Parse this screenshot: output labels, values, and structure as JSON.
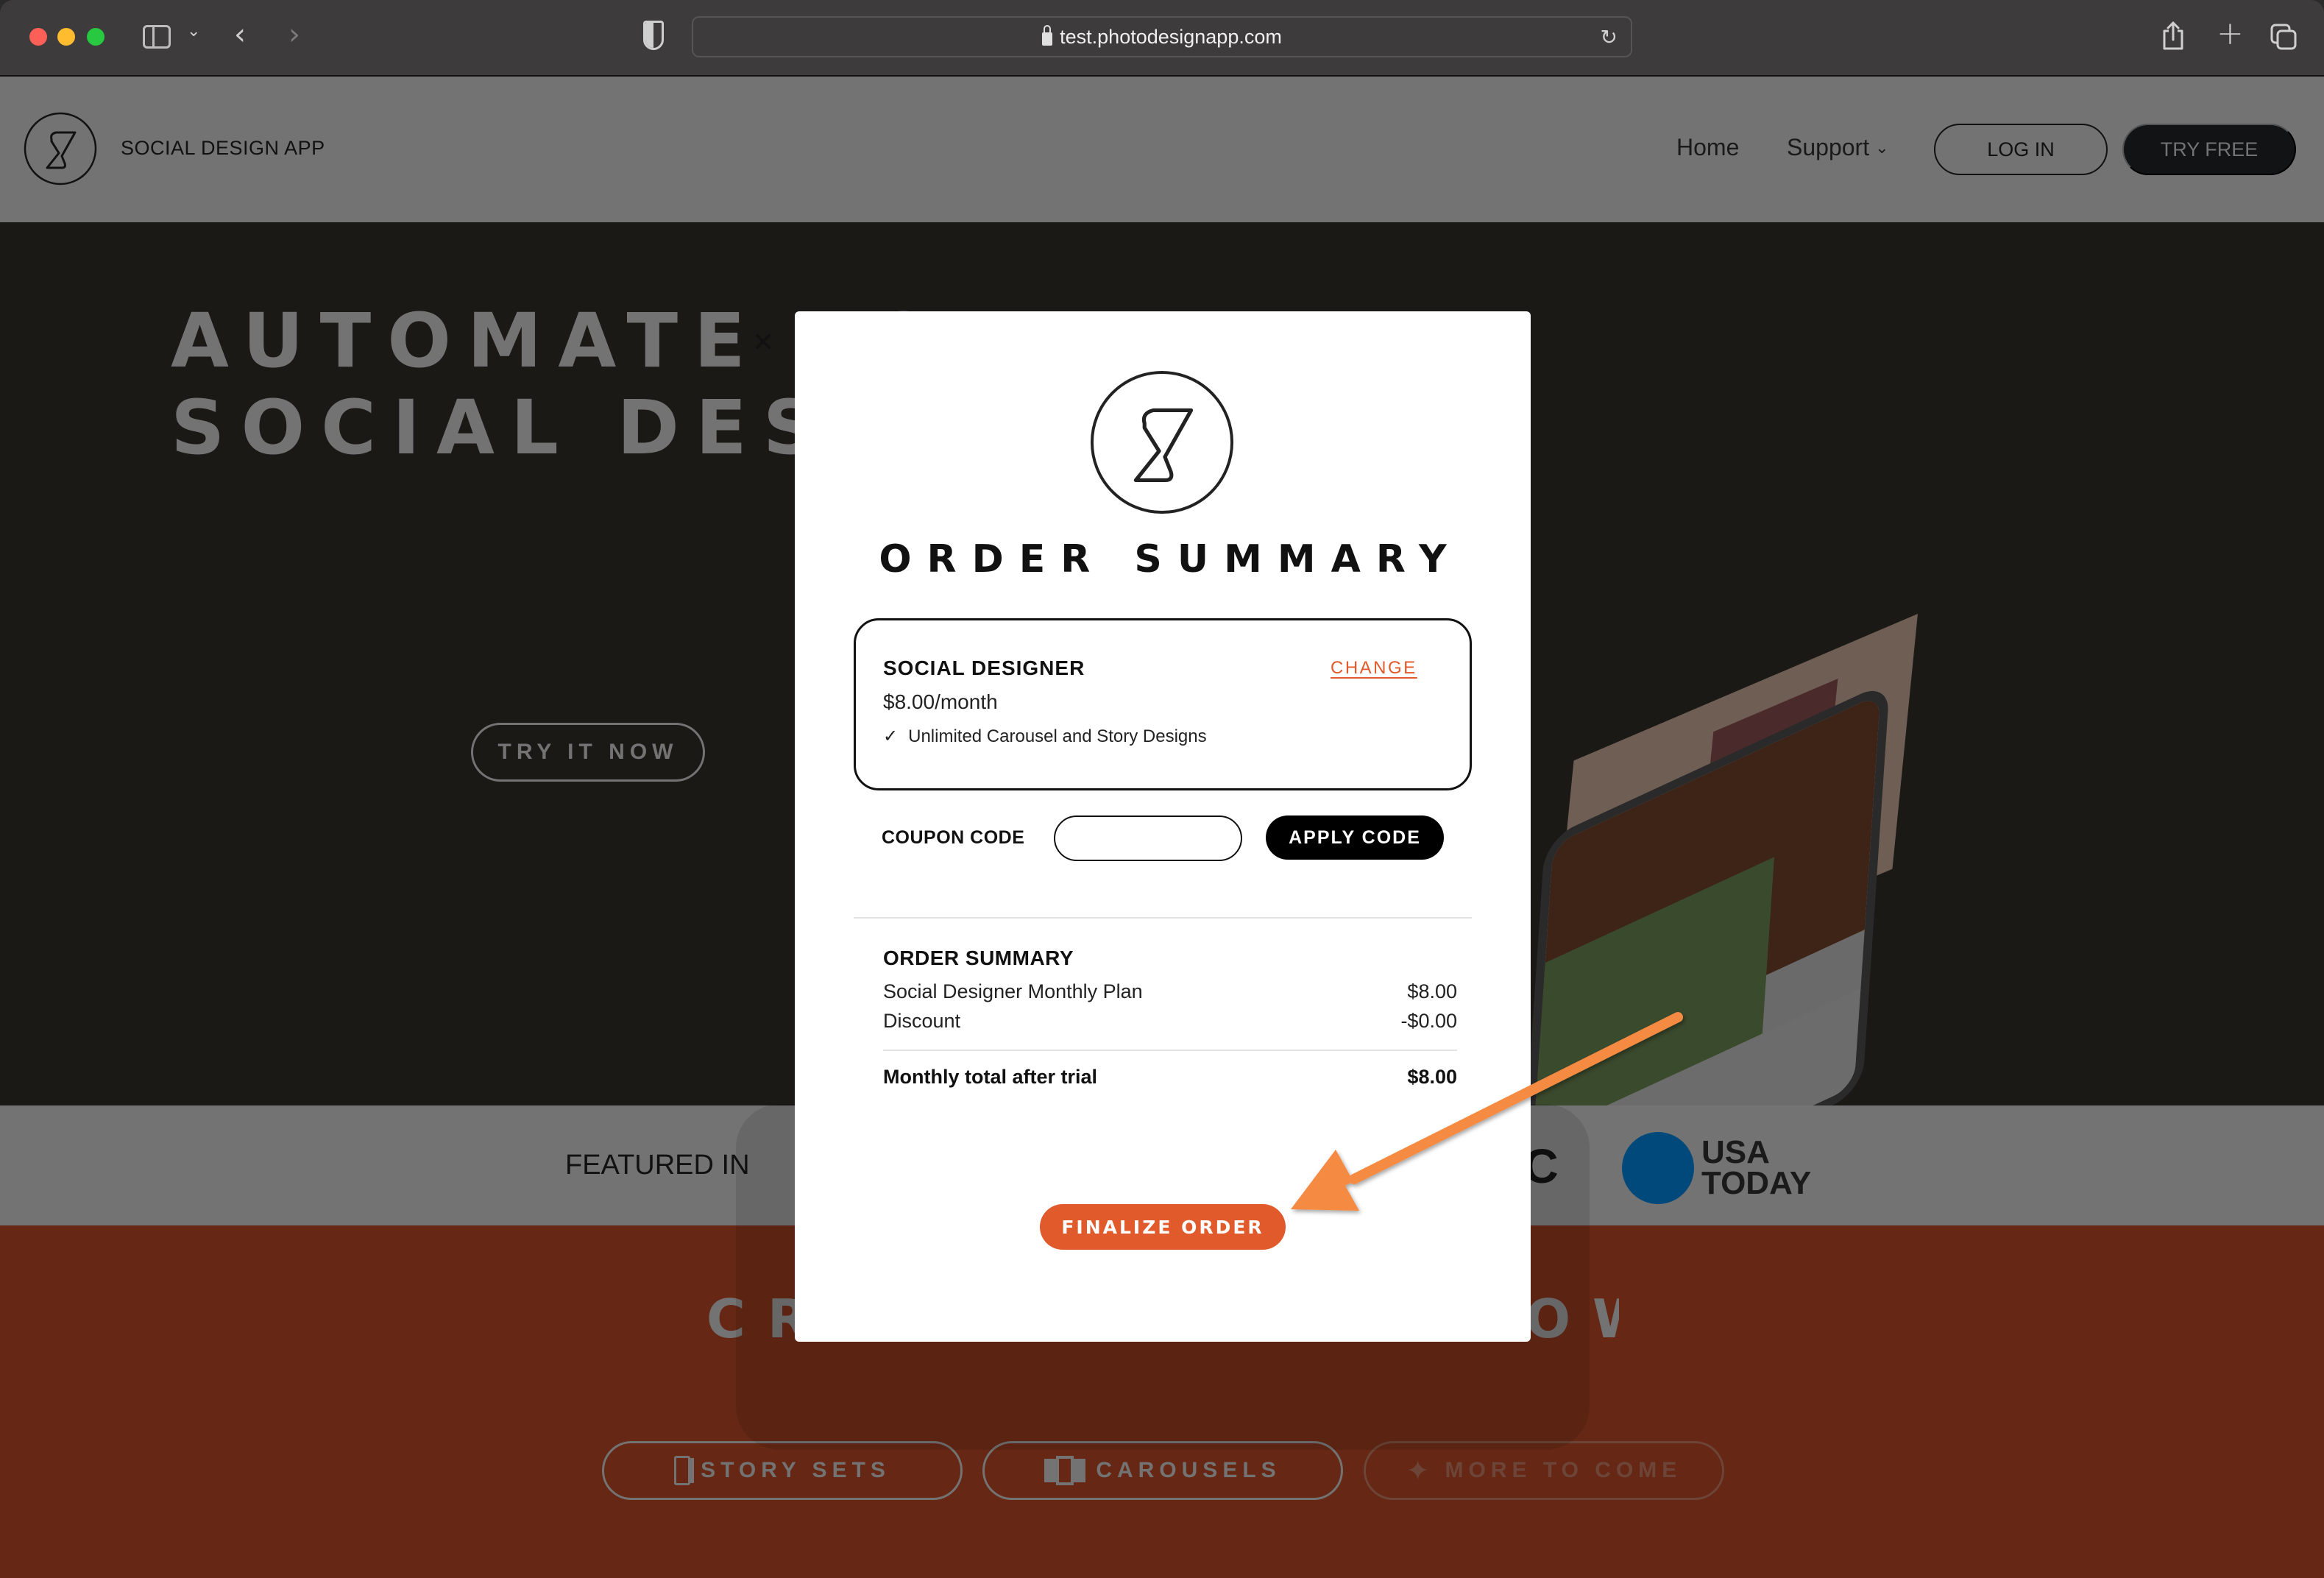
{
  "browser": {
    "url": "test.photodesignapp.com",
    "icons": {
      "close": "traffic-light-red",
      "minimize": "traffic-light-yellow",
      "maximize": "traffic-light-green",
      "sidebar": "sidebar-icon",
      "back": "chevron-left-icon",
      "forward": "chevron-right-icon",
      "privacy": "shield-icon",
      "lock": "lock-icon",
      "reload": "reload-icon",
      "share": "share-icon",
      "new_tab": "plus-icon",
      "tabs": "tabs-overview-icon"
    },
    "glyphs": {
      "sidebar_chevron": "⌄",
      "back": "‹",
      "forward": "›",
      "reload": "↻",
      "new_tab": "+"
    }
  },
  "site_header": {
    "brand_name": "SOCIAL DESIGN APP",
    "nav": {
      "home": "Home",
      "support": "Support",
      "support_chevron": "⌄"
    },
    "login_label": "LOG IN",
    "try_free_label": "TRY FREE"
  },
  "hero": {
    "title": "AUTOMATE YOUR\nSOCIAL DESIGN",
    "cta_label": "TRY IT NOW"
  },
  "featured": {
    "label": "FEATURED IN",
    "partial_logo": "C",
    "usa_today": "USA\nTODAY"
  },
  "create_section": {
    "title": "CREATE YOURS NOW",
    "pills": [
      {
        "label": "STORY SETS",
        "icon": "story-sets-icon"
      },
      {
        "label": "CAROUSELS",
        "icon": "carousels-icon"
      },
      {
        "label": "MORE TO COME",
        "icon": "sparkle-icon",
        "glyph": "✦"
      }
    ]
  },
  "modal": {
    "close_glyph": "✕",
    "title": "ORDER SUMMARY",
    "plan": {
      "name": "SOCIAL DESIGNER",
      "change_label": "CHANGE",
      "price": "$8.00/month",
      "check_glyph": "✓",
      "feature": "Unlimited Carousel and Story Designs"
    },
    "coupon": {
      "label": "COUPON CODE",
      "value": "",
      "placeholder": "",
      "apply_label": "APPLY CODE"
    },
    "summary": {
      "heading": "ORDER SUMMARY",
      "rows": [
        {
          "label": "Social Designer Monthly Plan",
          "amount": "$8.00"
        },
        {
          "label": "Discount",
          "amount": "-$0.00"
        }
      ],
      "total": {
        "label": "Monthly total after trial",
        "amount": "$8.00"
      }
    },
    "finalize_label": "FINALIZE ORDER"
  },
  "colors": {
    "accent": "#e05a2b",
    "annotation_arrow": "#f58a43",
    "usa_today_blue": "#00497a"
  }
}
